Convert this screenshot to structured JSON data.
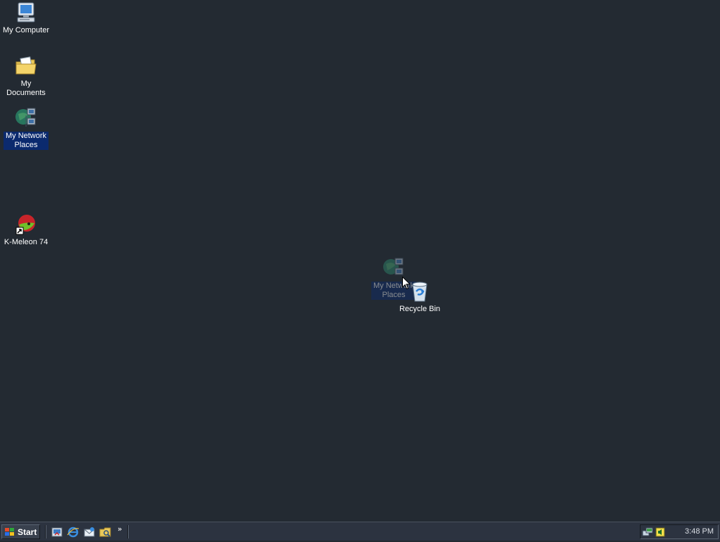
{
  "desktop": {
    "icons": [
      {
        "label": "My Computer",
        "icon": "my-computer-icon"
      },
      {
        "label": "My Documents",
        "icon": "my-documents-icon"
      },
      {
        "label": "My Network Places",
        "icon": "my-network-places-icon",
        "selected": true
      },
      {
        "label": "K-Meleon 74",
        "icon": "k-meleon-icon"
      },
      {
        "label": "Recycle Bin",
        "icon": "recycle-bin-icon"
      }
    ],
    "drag_ghost": {
      "label": "My Network Places",
      "icon": "my-network-places-icon"
    }
  },
  "taskbar": {
    "start_label": "Start",
    "quick_launch": [
      "show-desktop-icon",
      "internet-explorer-icon",
      "outlook-express-icon",
      "windows-explorer-icon"
    ],
    "overflow": "»",
    "tray_icons": [
      "network-icon",
      "volume-icon"
    ],
    "clock": "3:48 PM"
  },
  "colors": {
    "desktop": "#232a32",
    "taskbar": "#2c3340",
    "selection": "#0b2a6e"
  }
}
